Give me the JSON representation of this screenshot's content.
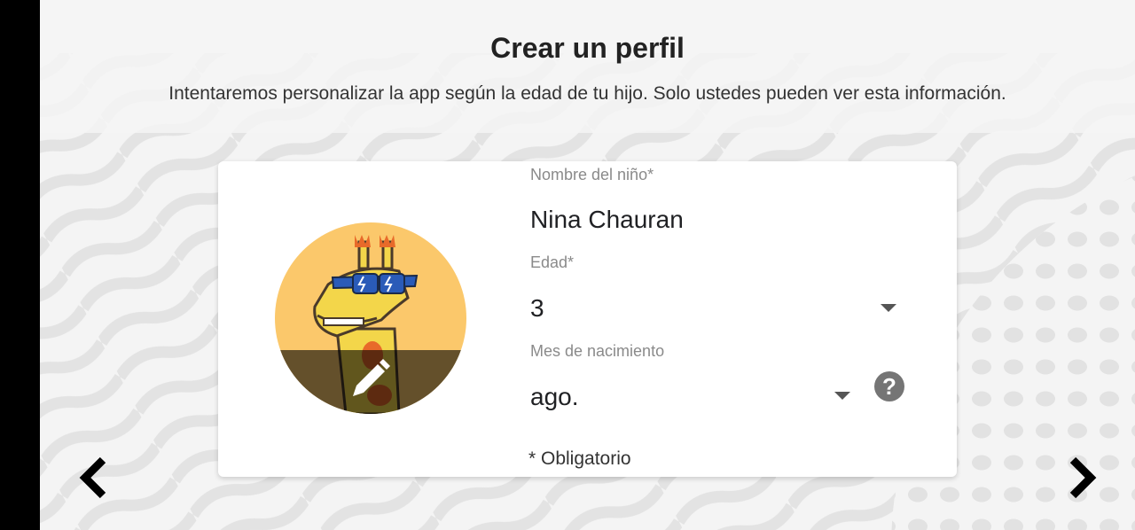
{
  "page": {
    "title": "Crear un perfil",
    "subtitle": "Intentaremos personalizar la app según la edad de tu hijo. Solo ustedes pueden ver esta información."
  },
  "avatar": {
    "icon": "giraffe-avatar-with-sunglasses",
    "edit_icon": "pencil-icon",
    "background_color": "#fbc86b"
  },
  "form": {
    "name": {
      "label": "Nombre del niño*",
      "value": "Nina Chauran"
    },
    "age": {
      "label": "Edad*",
      "value": "3"
    },
    "birth_month": {
      "label": "Mes de nacimiento",
      "value": "ago."
    },
    "help_icon": "?",
    "required_note": "* Obligatorio"
  },
  "navigation": {
    "back_icon": "chevron-left-icon",
    "next_icon": "chevron-right-icon"
  }
}
